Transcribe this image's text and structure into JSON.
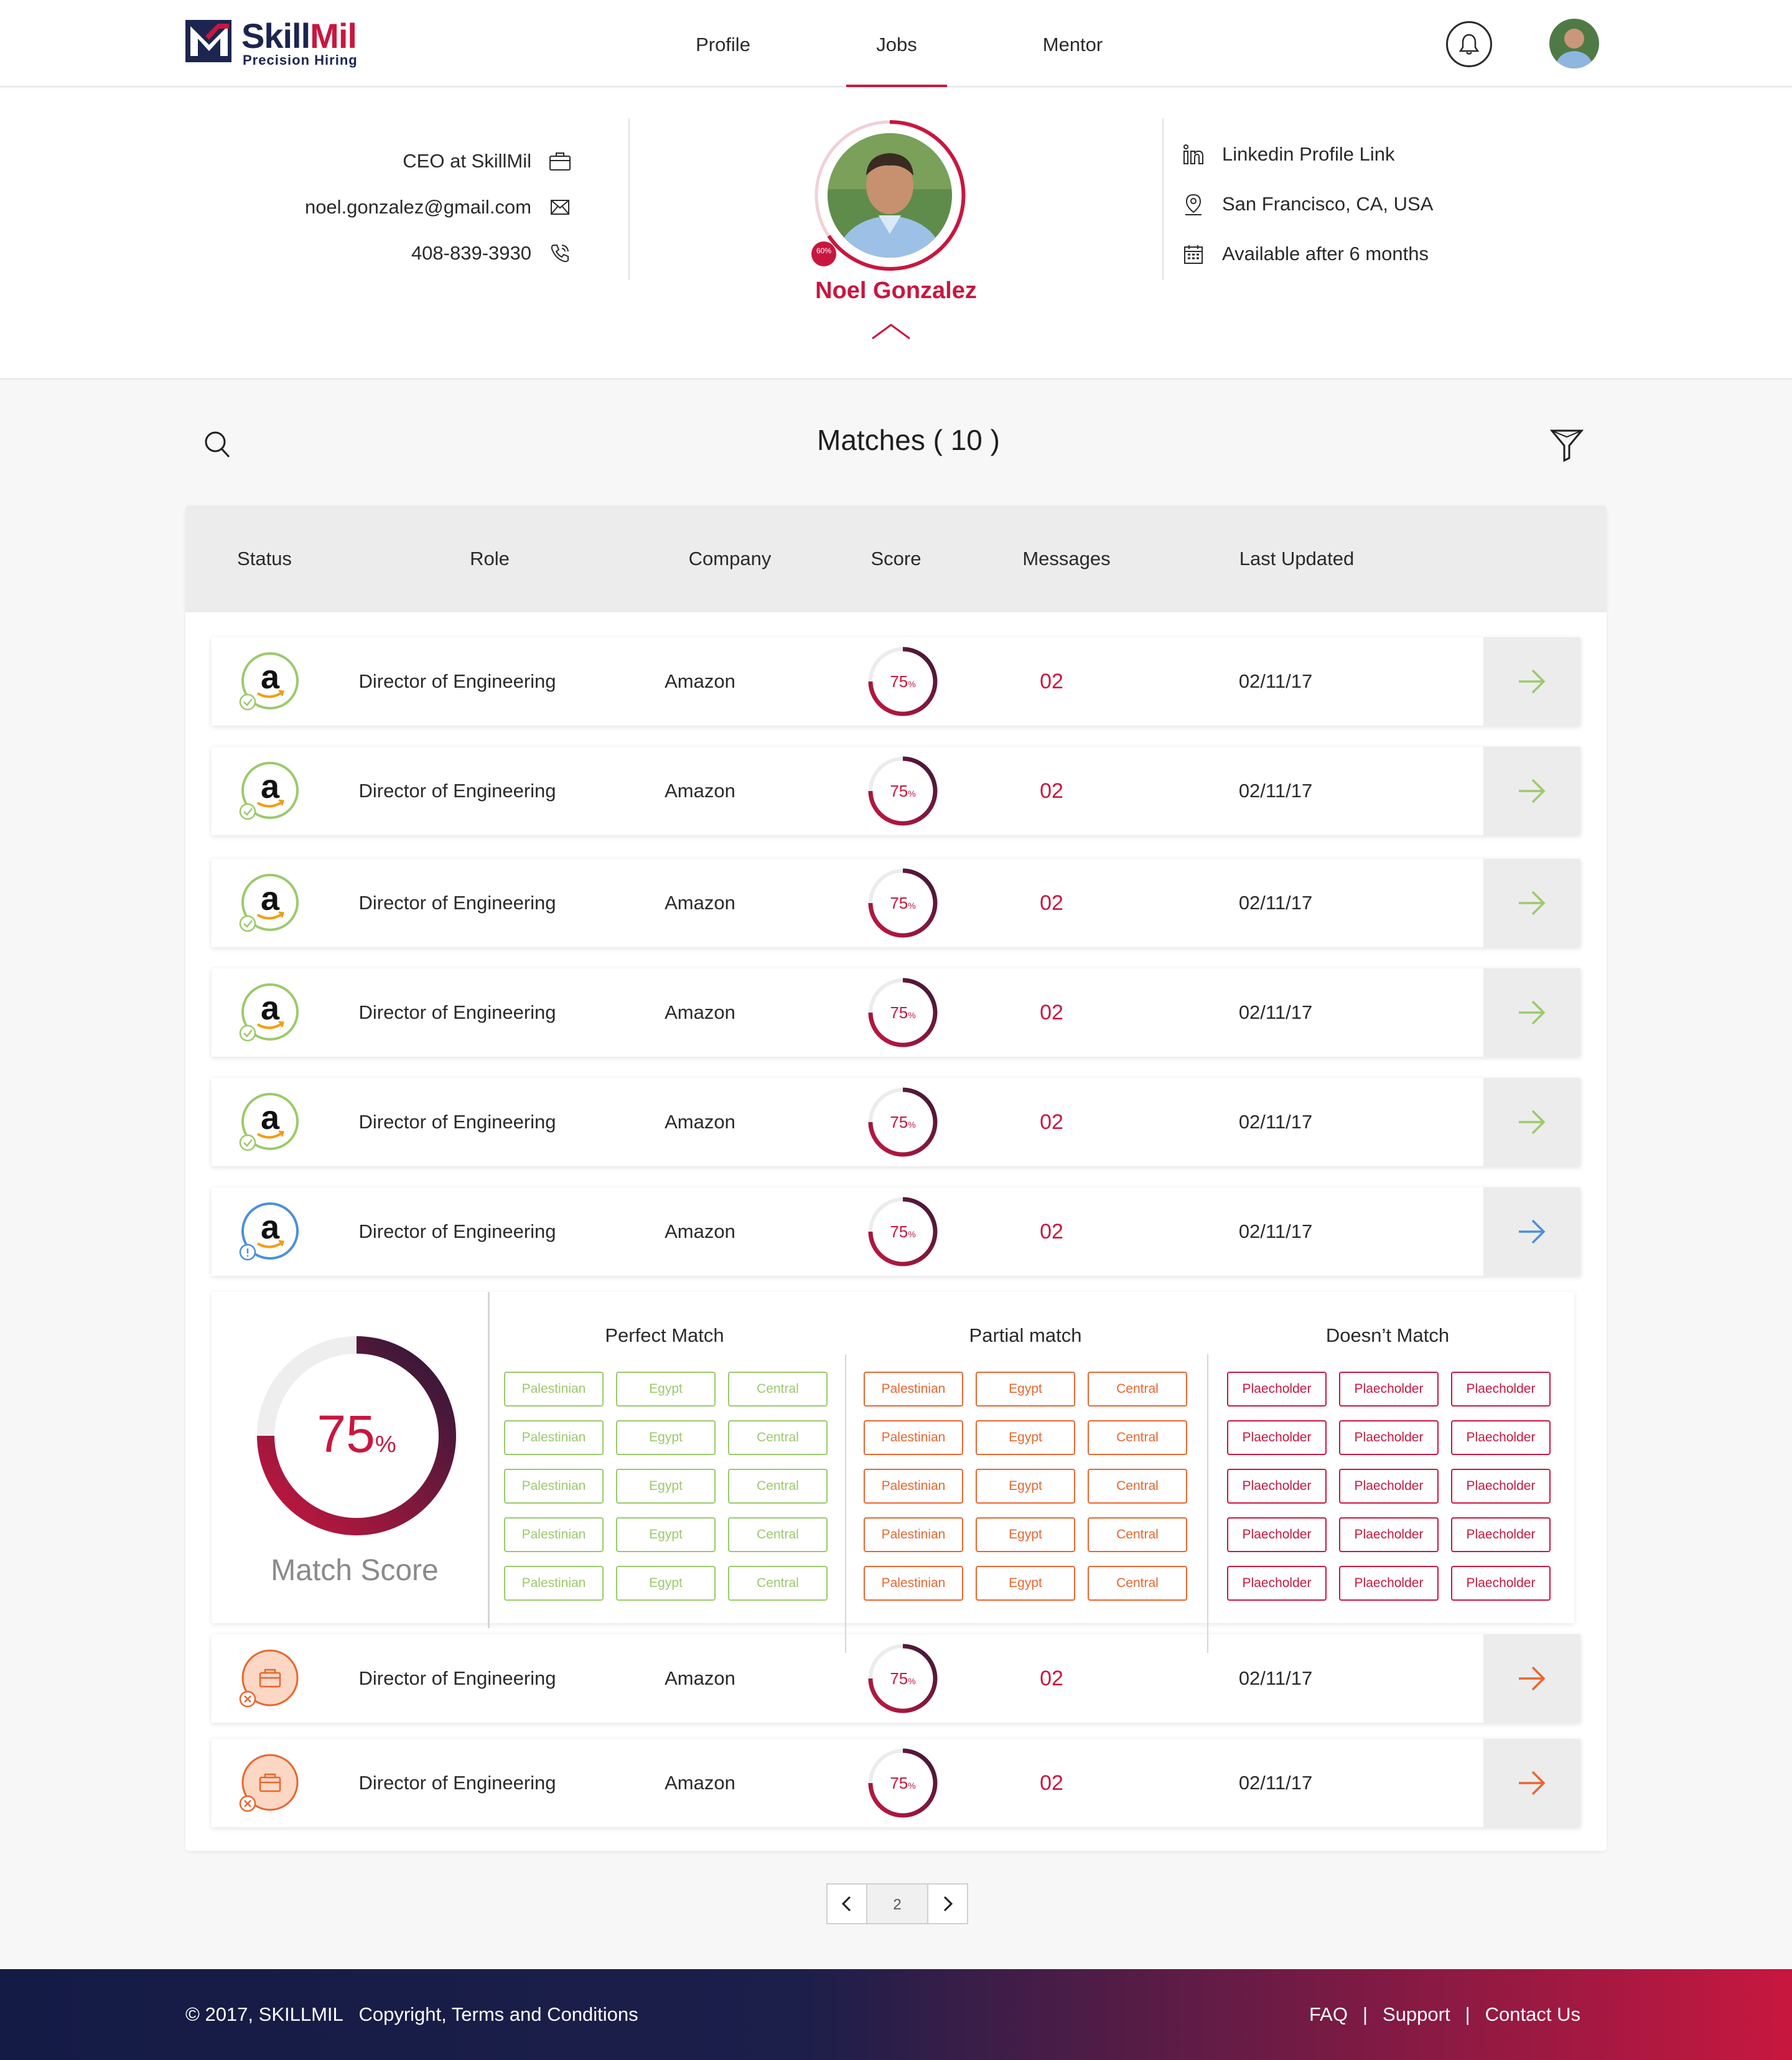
{
  "brand": {
    "name_part1": "Skill",
    "name_part2": "Mil",
    "tagline": "Precision  Hiring"
  },
  "nav": {
    "items": [
      {
        "label": "Profile"
      },
      {
        "label": "Jobs"
      },
      {
        "label": "Mentor"
      }
    ],
    "active": "Jobs"
  },
  "profile": {
    "title": "CEO at SkillMil",
    "email": "noel.gonzalez@gmail.com",
    "phone": "408-839-3930",
    "name": "Noel Gonzalez",
    "badge": "60%",
    "linkedin": "Linkedin Profile Link",
    "location": "San Francisco, CA, USA",
    "availability": "Available after 6 months"
  },
  "matches": {
    "title": "Matches ( 10 )",
    "columns": [
      "Status",
      "Role",
      "Company",
      "Score",
      "Messages",
      "Last Updated"
    ],
    "rows": [
      {
        "status": "matched",
        "role": "Director of Engineering",
        "company": "Amazon",
        "score": 75,
        "score_label": "75",
        "messages": "02",
        "updated": "02/11/17"
      },
      {
        "status": "matched",
        "role": "Director of Engineering",
        "company": "Amazon",
        "score": 75,
        "score_label": "75",
        "messages": "02",
        "updated": "02/11/17"
      },
      {
        "status": "matched",
        "role": "Director of Engineering",
        "company": "Amazon",
        "score": 75,
        "score_label": "75",
        "messages": "02",
        "updated": "02/11/17"
      },
      {
        "status": "matched",
        "role": "Director of Engineering",
        "company": "Amazon",
        "score": 75,
        "score_label": "75",
        "messages": "02",
        "updated": "02/11/17"
      },
      {
        "status": "matched",
        "role": "Director of Engineering",
        "company": "Amazon",
        "score": 75,
        "score_label": "75",
        "messages": "02",
        "updated": "02/11/17"
      },
      {
        "status": "pending",
        "role": "Director of Engineering",
        "company": "Amazon",
        "score": 75,
        "score_label": "75",
        "messages": "02",
        "updated": "02/11/17"
      },
      {
        "status": "rejected",
        "role": "Director of Engineering",
        "company": "Amazon",
        "score": 75,
        "score_label": "75",
        "messages": "02",
        "updated": "02/11/17"
      },
      {
        "status": "rejected",
        "role": "Director of Engineering",
        "company": "Amazon",
        "score": 75,
        "score_label": "75",
        "messages": "02",
        "updated": "02/11/17"
      }
    ],
    "percent_sign": "%"
  },
  "match_detail": {
    "score": 75,
    "score_label": "75",
    "label": "Match Score",
    "perfect": {
      "title": "Perfect Match",
      "tags": [
        "Palestinian",
        "Egypt",
        "Central",
        "Palestinian",
        "Egypt",
        "Central",
        "Palestinian",
        "Egypt",
        "Central",
        "Palestinian",
        "Egypt",
        "Central",
        "Palestinian",
        "Egypt",
        "Central"
      ]
    },
    "partial": {
      "title": "Partial match",
      "tags": [
        "Palestinian",
        "Egypt",
        "Central",
        "Palestinian",
        "Egypt",
        "Central",
        "Palestinian",
        "Egypt",
        "Central",
        "Palestinian",
        "Egypt",
        "Central",
        "Palestinian",
        "Egypt",
        "Central"
      ]
    },
    "nomatch": {
      "title": "Doesn’t Match",
      "tags": [
        "Plaecholder",
        "Plaecholder",
        "Plaecholder",
        "Plaecholder",
        "Plaecholder",
        "Plaecholder",
        "Plaecholder",
        "Plaecholder",
        "Plaecholder",
        "Plaecholder",
        "Plaecholder",
        "Plaecholder",
        "Plaecholder",
        "Plaecholder",
        "Plaecholder"
      ]
    }
  },
  "pagination": {
    "current": "2"
  },
  "footer": {
    "copyright": "© 2017, SKILLMIL   Copyright, Terms and Conditions",
    "links": [
      "FAQ",
      "Support",
      "Contact Us"
    ],
    "separator": "|"
  },
  "colors": {
    "accent": "#c8173f",
    "navy": "#1c2550",
    "green": "#9cc96b",
    "orange": "#e8662f",
    "blue": "#4a90d9"
  },
  "icons": [
    "bell-icon",
    "search-icon",
    "filter-icon",
    "briefcase-icon",
    "mail-icon",
    "phone-icon",
    "linkedin-icon",
    "location-icon",
    "calendar-icon",
    "arrow-right-icon",
    "chevron-up-icon",
    "chevron-left-icon",
    "chevron-right-icon"
  ]
}
